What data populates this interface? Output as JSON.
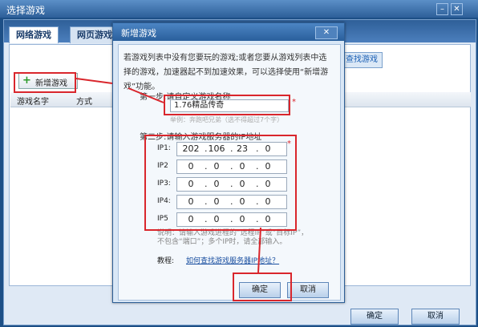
{
  "window": {
    "title": "选择游戏"
  },
  "tabs": [
    {
      "label": "网络游戏"
    },
    {
      "label": "网页游戏"
    }
  ],
  "toolbar": {
    "add_label": "新增游戏",
    "search_label": "查找游戏"
  },
  "table": {
    "columns": [
      "游戏名字",
      "方式"
    ]
  },
  "footer": {
    "ok": "确定",
    "cancel": "取消"
  },
  "dialog": {
    "title": "新增游戏",
    "intro": "若游戏列表中没有您要玩的游戏;或者您要从游戏列表中选择的游戏，加速器起不到加速效果，可以选择使用“新增游戏”功能。",
    "step1": "第一步:请自定义游戏名称",
    "name_value": "1.76精品传奇",
    "hint": "举例：奔跑吧兄弟（选不得超过7个字）",
    "step2": "第二步:请输入游戏服务器的IP地址",
    "ips": [
      {
        "label": "IP1:",
        "octets": [
          "202",
          "106",
          "23",
          "0"
        ]
      },
      {
        "label": "IP2",
        "octets": [
          "0",
          "0",
          "0",
          "0"
        ]
      },
      {
        "label": "IP3:",
        "octets": [
          "0",
          "0",
          "0",
          "0"
        ]
      },
      {
        "label": "IP4:",
        "octets": [
          "0",
          "0",
          "0",
          "0"
        ]
      },
      {
        "label": "IP5",
        "octets": [
          "0",
          "0",
          "0",
          "0"
        ]
      }
    ],
    "note": "说明：请输入游戏进程的“远程IP”或“目标IP”，不包含“端口”；多个IP时，请全部输入。",
    "tutorial_label": "教程:",
    "tutorial_link": "如何查找游戏服务器IP地址？",
    "ok": "确定",
    "cancel": "取消"
  }
}
